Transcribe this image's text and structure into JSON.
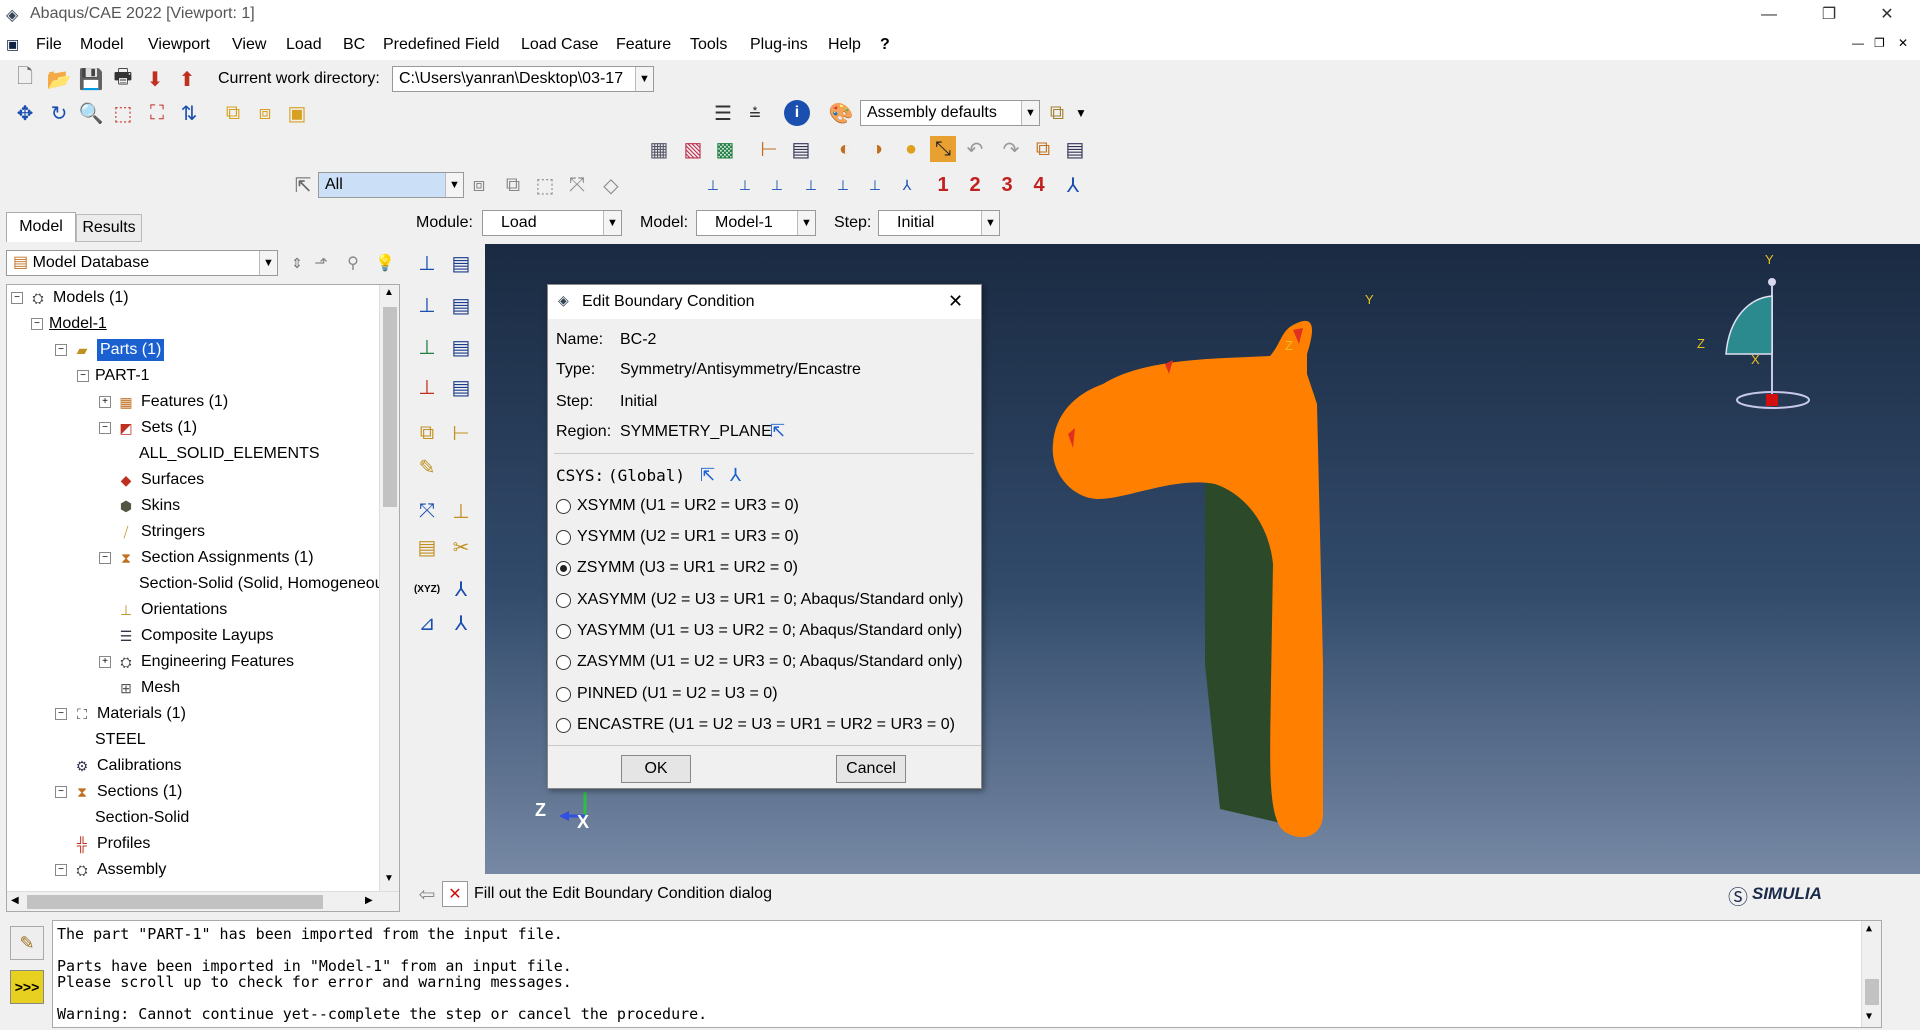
{
  "window": {
    "title": "Abaqus/CAE 2022 [Viewport: 1]"
  },
  "menu": [
    "File",
    "Model",
    "Viewport",
    "View",
    "Load",
    "BC",
    "Predefined Field",
    "Load Case",
    "Feature",
    "Tools",
    "Plug-ins",
    "Help",
    "?"
  ],
  "toolbar": {
    "workdir_label": "Current work directory:",
    "workdir_value": "C:\\Users\\yanran\\Desktop\\03-17",
    "render_style": "Assembly defaults",
    "selection_filter": "All",
    "csys_numbers": [
      "1",
      "2",
      "3",
      "4"
    ]
  },
  "context": {
    "module_label": "Module:",
    "module_value": "Load",
    "model_label": "Model:",
    "model_value": "Model-1",
    "step_label": "Step:",
    "step_value": "Initial"
  },
  "tabs": [
    "Model",
    "Results"
  ],
  "tree": {
    "root_combo": "Model Database",
    "rows": [
      "Models (1)",
      "Model-1",
      "Parts (1)",
      "PART-1",
      "Features (1)",
      "Sets (1)",
      "ALL_SOLID_ELEMENTS",
      "Surfaces",
      "Skins",
      "Stringers",
      "Section Assignments (1)",
      "Section-Solid (Solid, Homogeneous)",
      "Orientations",
      "Composite Layups",
      "Engineering Features",
      "Mesh",
      "Materials (1)",
      "STEEL",
      "Calibrations",
      "Sections (1)",
      "Section-Solid",
      "Profiles",
      "Assembly"
    ]
  },
  "dialog": {
    "title": "Edit Boundary Condition",
    "name_label": "Name:",
    "name_value": "BC-2",
    "type_label": "Type:",
    "type_value": "Symmetry/Antisymmetry/Encastre",
    "step_label": "Step:",
    "step_value": "Initial",
    "region_label": "Region:",
    "region_value": "SYMMETRY_PLANE",
    "csys_label": "CSYS:",
    "csys_value": "(Global)",
    "options": [
      "XSYMM (U1 = UR2 = UR3 = 0)",
      "YSYMM (U2 = UR1 = UR3 = 0)",
      "ZSYMM (U3 = UR1 = UR2 = 0)",
      "XASYMM (U2 = U3 = UR1 = 0; Abaqus/Standard only)",
      "YASYMM (U1 = U3 = UR2 = 0; Abaqus/Standard only)",
      "ZASYMM (U1 = U2 = UR3 = 0; Abaqus/Standard only)",
      "PINNED (U1 = U2 = U3 = 0)",
      "ENCASTRE (U1 = U2 = U3 = UR1 = UR2 = UR3 = 0)"
    ],
    "selected_index": 2,
    "ok_label": "OK",
    "cancel_label": "Cancel"
  },
  "viewport": {
    "triad_labels": {
      "y": "Y",
      "z": "Z",
      "x": "X"
    },
    "origin_labels": {
      "z": "Z",
      "y": "Y",
      "x": "X"
    },
    "part_color": "#ff8000"
  },
  "prompt": {
    "text": "Fill out the Edit Boundary Condition dialog"
  },
  "brand": "SIMULIA",
  "messages": [
    "The part \"PART-1\" has been imported from the input file.",
    "Parts have been imported in \"Model-1\" from an input file.",
    "Please scroll up to check for error and warning messages.",
    "Warning: Cannot continue yet--complete the step or cancel the procedure."
  ]
}
